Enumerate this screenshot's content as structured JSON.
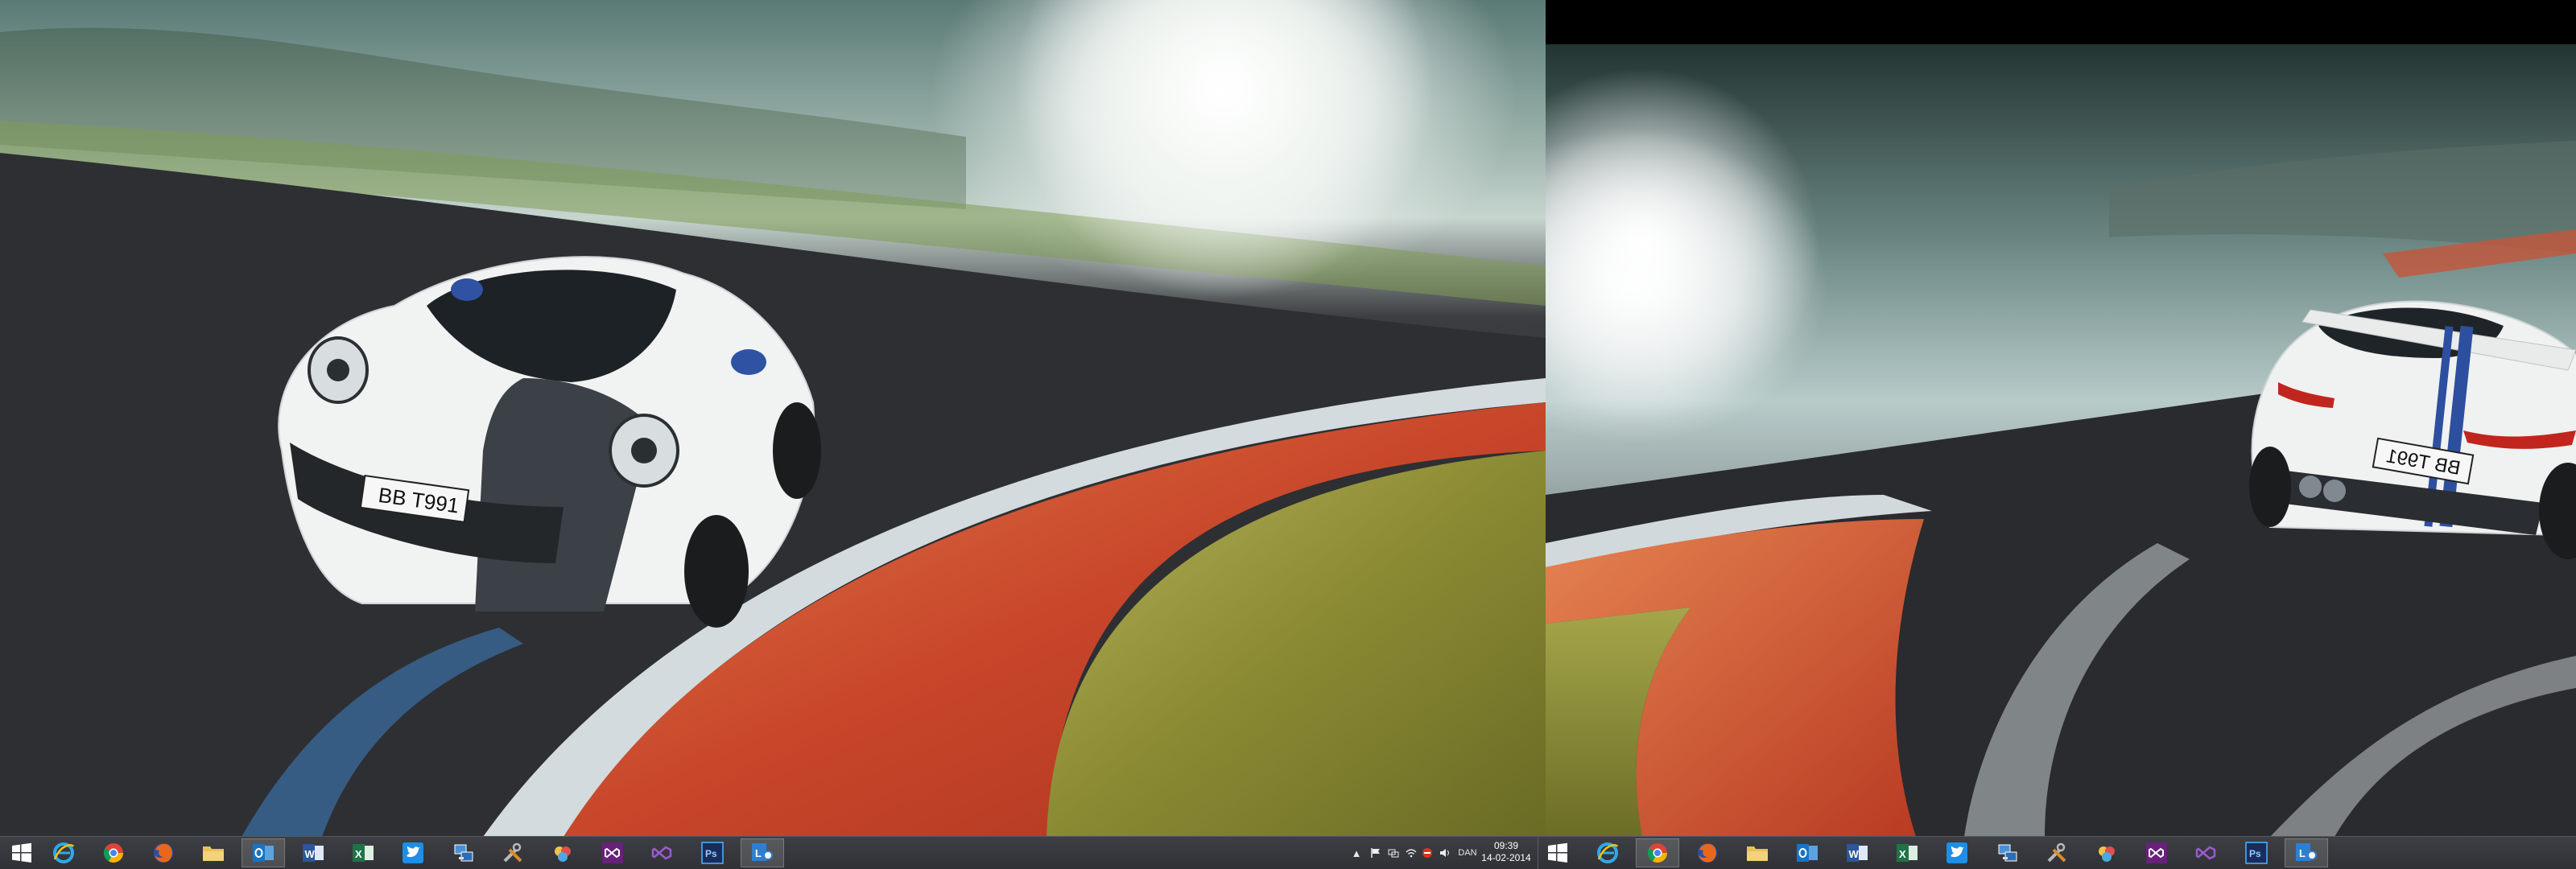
{
  "monitors": {
    "left": {
      "wallpaper": "Porsche 911 Turbo front view on race track",
      "plate": "BB T991"
    },
    "right": {
      "wallpaper": "Porsche 911 Turbo rear view on race track",
      "plate": "BB T991"
    }
  },
  "taskbar": {
    "left_apps": [
      {
        "name": "start",
        "icon": "windows-logo-icon"
      },
      {
        "name": "internet-explorer",
        "icon": "ie-icon"
      },
      {
        "name": "chrome",
        "icon": "chrome-icon"
      },
      {
        "name": "firefox",
        "icon": "firefox-icon"
      },
      {
        "name": "file-explorer",
        "icon": "folder-icon"
      },
      {
        "name": "outlook",
        "icon": "outlook-icon",
        "active": true
      },
      {
        "name": "word",
        "icon": "word-icon"
      },
      {
        "name": "excel",
        "icon": "excel-icon"
      },
      {
        "name": "twitter",
        "icon": "twitter-icon"
      },
      {
        "name": "network",
        "icon": "network-icon"
      },
      {
        "name": "tools",
        "icon": "tools-icon"
      },
      {
        "name": "paint",
        "icon": "paint-icon"
      },
      {
        "name": "visual-studio",
        "icon": "visual-studio-icon"
      },
      {
        "name": "visual-studio-2",
        "icon": "visual-studio-icon"
      },
      {
        "name": "photoshop",
        "icon": "photoshop-icon",
        "label": "Ps"
      },
      {
        "name": "lync",
        "icon": "lync-icon",
        "active": true
      }
    ],
    "tray": {
      "language": "DAN",
      "time": "09:39",
      "date": "14-02-2014"
    }
  },
  "colors": {
    "taskbar": "#33353a",
    "accent_twitter": "#1e8ee6",
    "accent_word": "#2b579a",
    "accent_excel": "#217346",
    "accent_outlook": "#1a73c2",
    "accent_vs": "#68217a",
    "accent_ps": "#1b2c5c"
  }
}
